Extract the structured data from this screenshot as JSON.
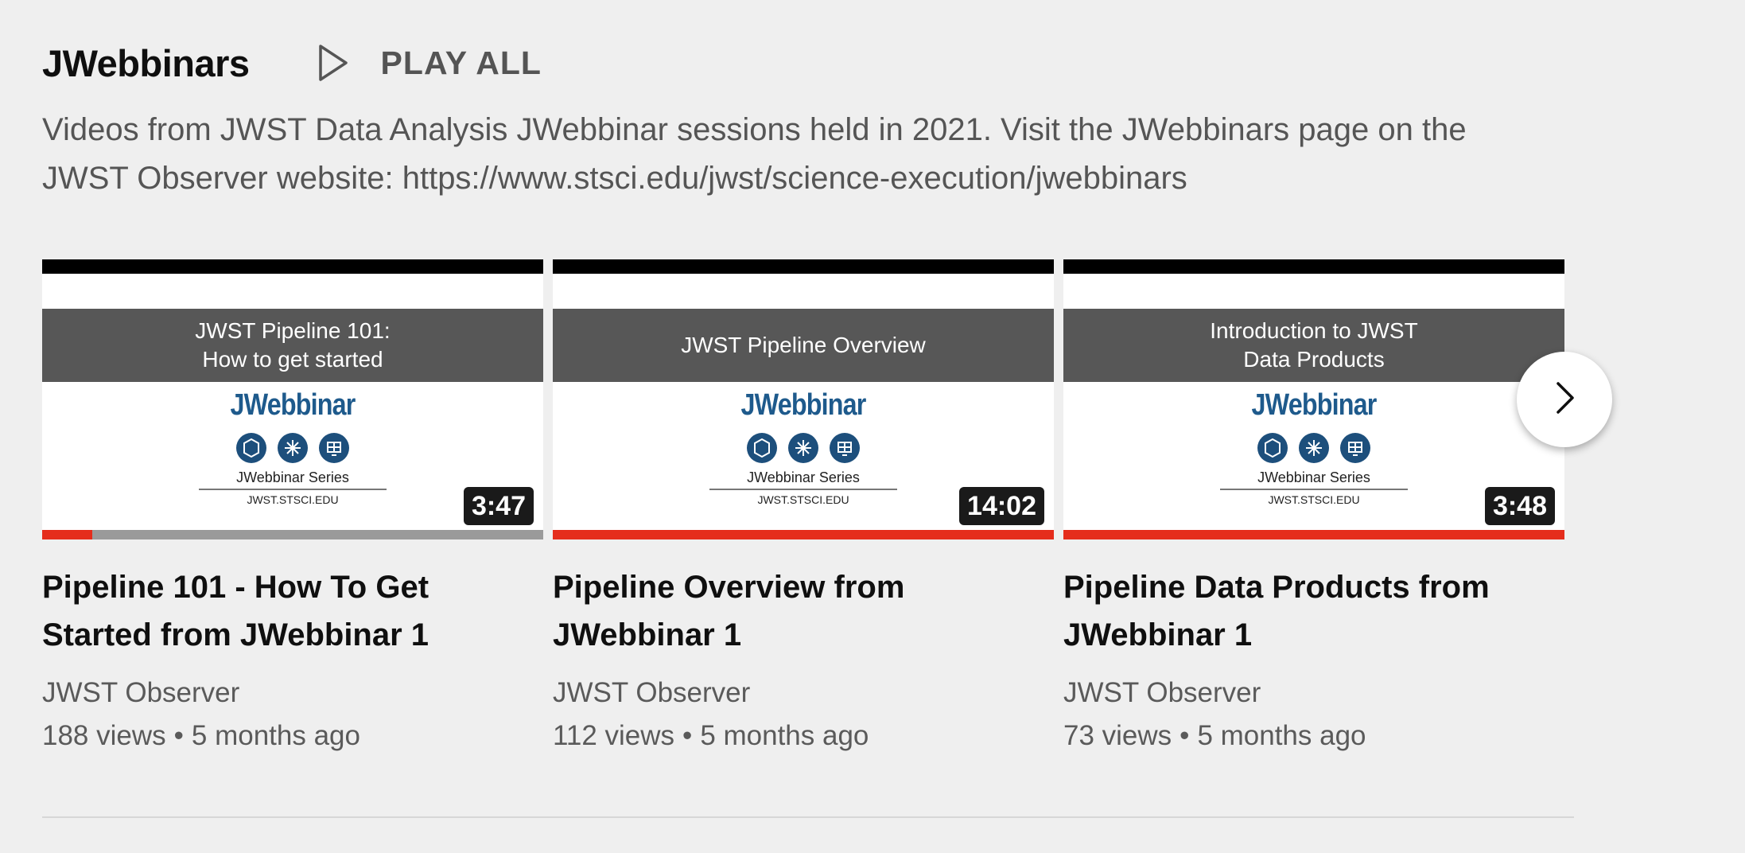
{
  "shelf": {
    "title": "JWebbinars",
    "play_all_label": "PLAY ALL",
    "description": "Videos from JWST Data Analysis JWebbinar sessions held in 2021. Visit the JWebbinars page on the JWST Observer website: https://www.stsci.edu/jwst/science-execution/jwebbinars"
  },
  "videos": [
    {
      "title": "Pipeline 101 - How To Get Started from JWebbinar 1",
      "channel": "JWST Observer",
      "views": "188 views",
      "age": "5 months ago",
      "duration": "3:47",
      "watched_fraction": 0.1,
      "thumb_banner": "JWST Pipeline 101:\nHow to get started",
      "thumb_brand": "JWebbinar",
      "thumb_series": "JWebbinar Series",
      "thumb_site": "JWST.STSCI.EDU"
    },
    {
      "title": "Pipeline Overview from JWebbinar 1",
      "channel": "JWST Observer",
      "views": "112 views",
      "age": "5 months ago",
      "duration": "14:02",
      "watched_fraction": 1.0,
      "thumb_banner": "JWST Pipeline Overview",
      "thumb_brand": "JWebbinar",
      "thumb_series": "JWebbinar Series",
      "thumb_site": "JWST.STSCI.EDU"
    },
    {
      "title": "Pipeline Data Products from JWebbinar 1",
      "channel": "JWST Observer",
      "views": "73 views",
      "age": "5 months ago",
      "duration": "3:48",
      "watched_fraction": 1.0,
      "thumb_banner": "Introduction to JWST\nData Products",
      "thumb_brand": "JWebbinar",
      "thumb_series": "JWebbinar Series",
      "thumb_site": "JWST.STSCI.EDU"
    }
  ],
  "meta_separator": "•",
  "icons": {
    "play_all": "play-outline-icon",
    "next": "chevron-right-icon"
  },
  "colors": {
    "background": "#efefef",
    "progress": "#e52d1c",
    "brand_blue": "#1e5a8c"
  }
}
